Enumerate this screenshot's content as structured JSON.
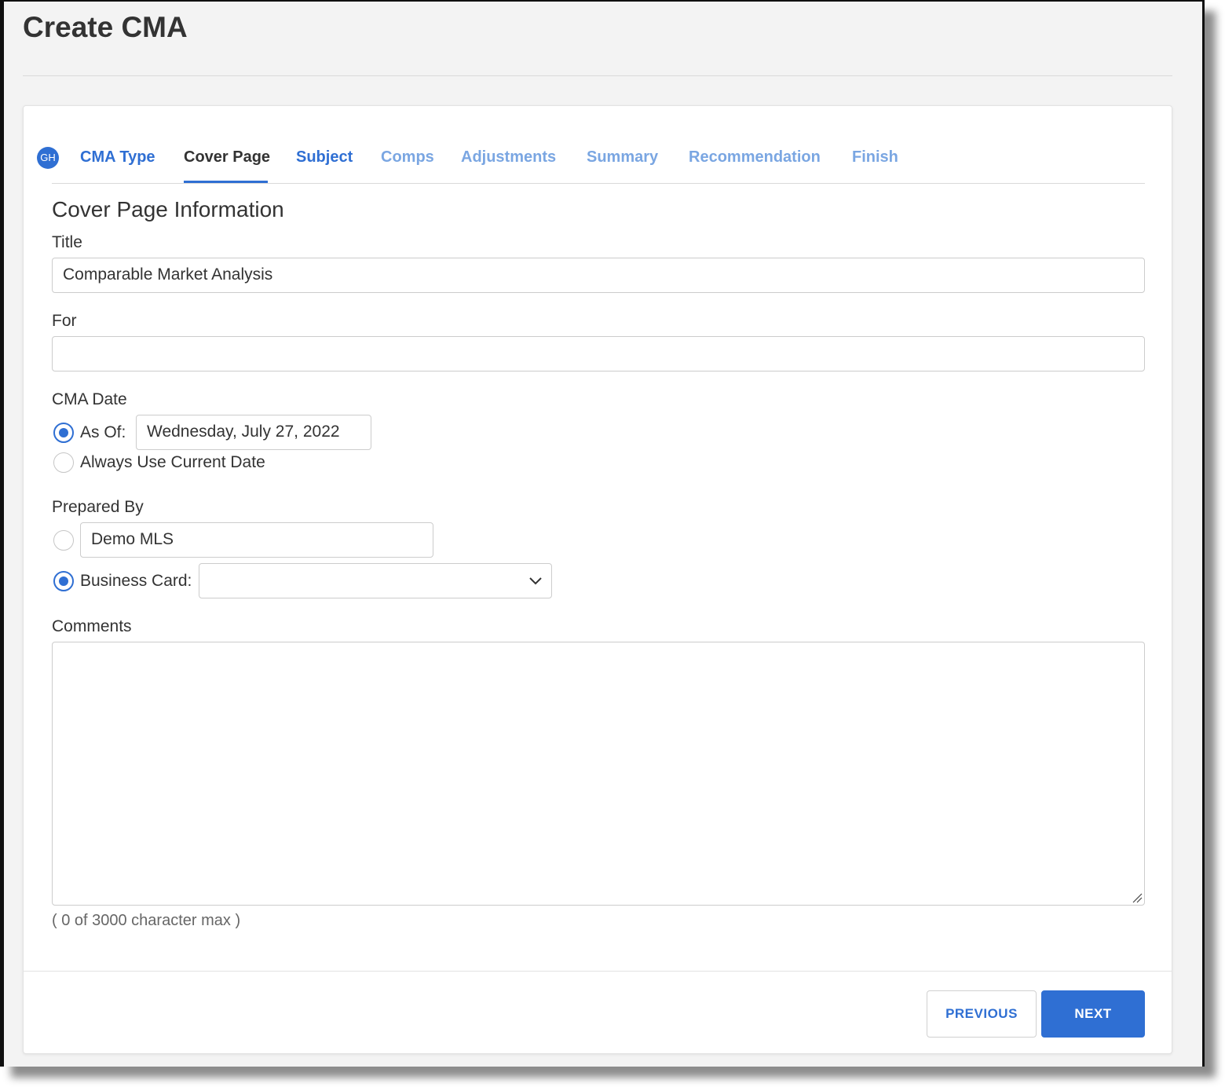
{
  "page": {
    "title": "Create CMA"
  },
  "user": {
    "initials": "GH"
  },
  "tabs": [
    {
      "label": "CMA Type",
      "state": "done"
    },
    {
      "label": "Cover Page",
      "state": "active"
    },
    {
      "label": "Subject",
      "state": "done"
    },
    {
      "label": "Comps",
      "state": "future"
    },
    {
      "label": "Adjustments",
      "state": "future"
    },
    {
      "label": "Summary",
      "state": "future"
    },
    {
      "label": "Recommendation",
      "state": "future"
    },
    {
      "label": "Finish",
      "state": "future"
    }
  ],
  "form": {
    "section_title": "Cover Page Information",
    "title_label": "Title",
    "title_value": "Comparable Market Analysis",
    "for_label": "For",
    "for_value": "",
    "cma_date_label": "CMA Date",
    "as_of_label": "As Of:",
    "as_of_value": "Wednesday, July 27, 2022",
    "as_of_checked": true,
    "current_date_label": "Always Use Current Date",
    "current_date_checked": false,
    "prepared_by_label": "Prepared By",
    "prepared_by_value": "Demo MLS",
    "prepared_by_checked": false,
    "business_card_label": "Business Card:",
    "business_card_value": "",
    "business_card_checked": true,
    "comments_label": "Comments",
    "comments_value": "",
    "char_count": "( 0 of 3000 character max )"
  },
  "buttons": {
    "previous": "PREVIOUS",
    "next": "NEXT"
  },
  "colors": {
    "accent": "#2f6fd3",
    "tab_future": "#7aa6e2",
    "background": "#f3f3f3"
  }
}
